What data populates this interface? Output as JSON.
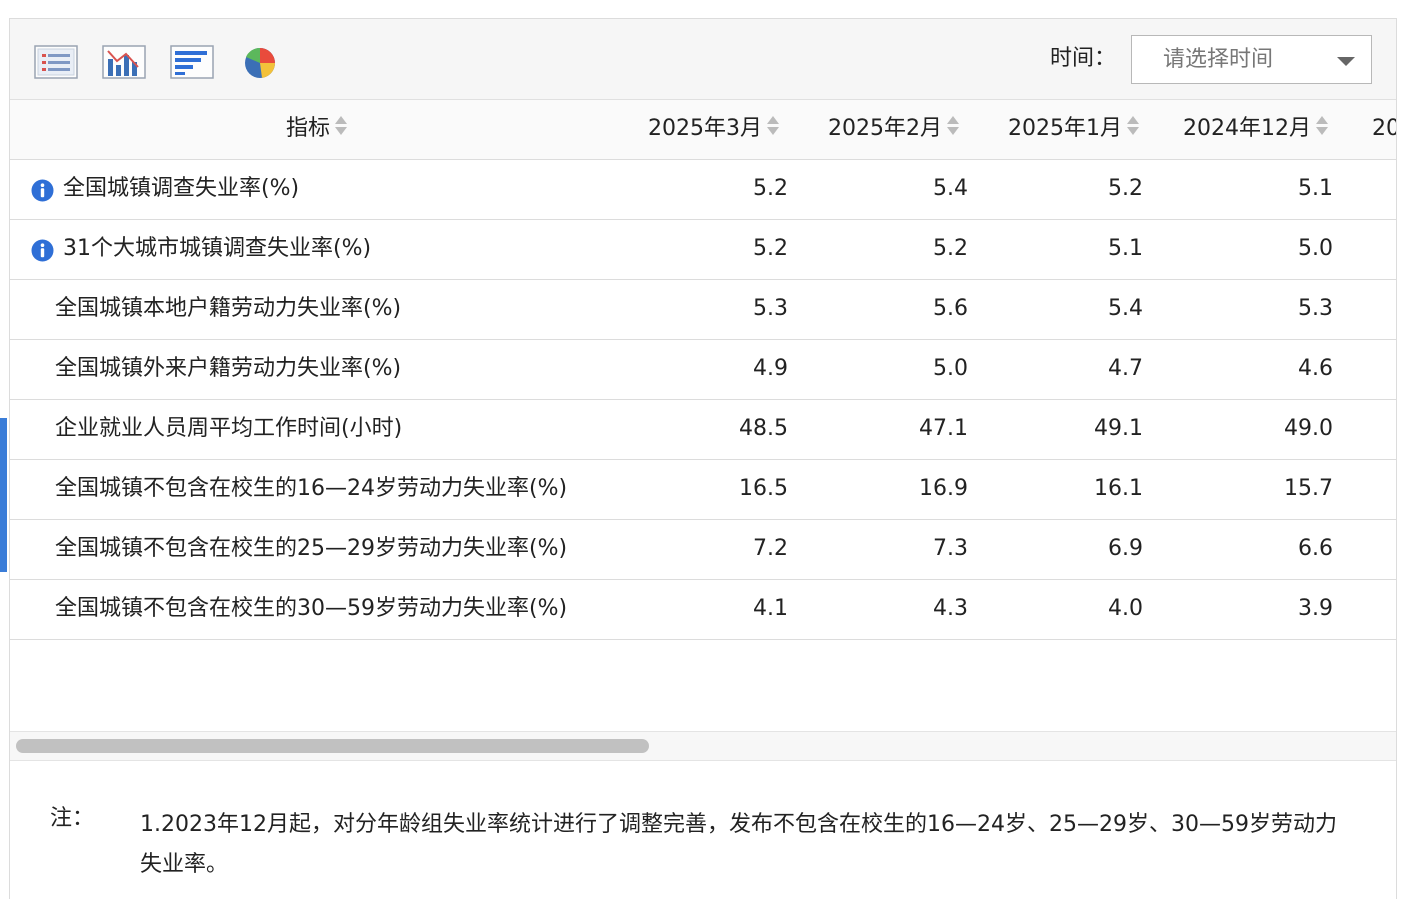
{
  "toolbar": {
    "icons": [
      "table-view-icon",
      "bar-line-chart-icon",
      "horizontal-bar-chart-icon",
      "pie-chart-icon"
    ],
    "time_label": "时间：",
    "time_select_placeholder": "请选择时间"
  },
  "table": {
    "headers": [
      "指标",
      "2025年3月",
      "2025年2月",
      "2025年1月",
      "2024年12月",
      "20"
    ],
    "rows": [
      {
        "name": "全国城镇调查失业率(%)",
        "info": true,
        "values": [
          "5.2",
          "5.4",
          "5.2",
          "5.1"
        ]
      },
      {
        "name": "31个大城市城镇调查失业率(%)",
        "info": true,
        "values": [
          "5.2",
          "5.2",
          "5.1",
          "5.0"
        ]
      },
      {
        "name": "全国城镇本地户籍劳动力失业率(%)",
        "info": false,
        "values": [
          "5.3",
          "5.6",
          "5.4",
          "5.3"
        ]
      },
      {
        "name": "全国城镇外来户籍劳动力失业率(%)",
        "info": false,
        "values": [
          "4.9",
          "5.0",
          "4.7",
          "4.6"
        ]
      },
      {
        "name": "企业就业人员周平均工作时间(小时)",
        "info": false,
        "values": [
          "48.5",
          "47.1",
          "49.1",
          "49.0"
        ]
      },
      {
        "name": "全国城镇不包含在校生的16—24岁劳动力失业率(%)",
        "info": false,
        "values": [
          "16.5",
          "16.9",
          "16.1",
          "15.7"
        ]
      },
      {
        "name": "全国城镇不包含在校生的25—29岁劳动力失业率(%)",
        "info": false,
        "values": [
          "7.2",
          "7.3",
          "6.9",
          "6.6"
        ]
      },
      {
        "name": "全国城镇不包含在校生的30—59岁劳动力失业率(%)",
        "info": false,
        "values": [
          "4.1",
          "4.3",
          "4.0",
          "3.9"
        ]
      }
    ]
  },
  "note": {
    "label": "注：",
    "text": "1.2023年12月起，对分年龄组失业率统计进行了调整完善，发布不包含在校生的16—24岁、25—29岁、30—59岁劳动力失业率。"
  },
  "colors": {
    "accent": "#3b7dd8",
    "info_icon": "#2f6fd6",
    "border": "#dcdcdc"
  }
}
